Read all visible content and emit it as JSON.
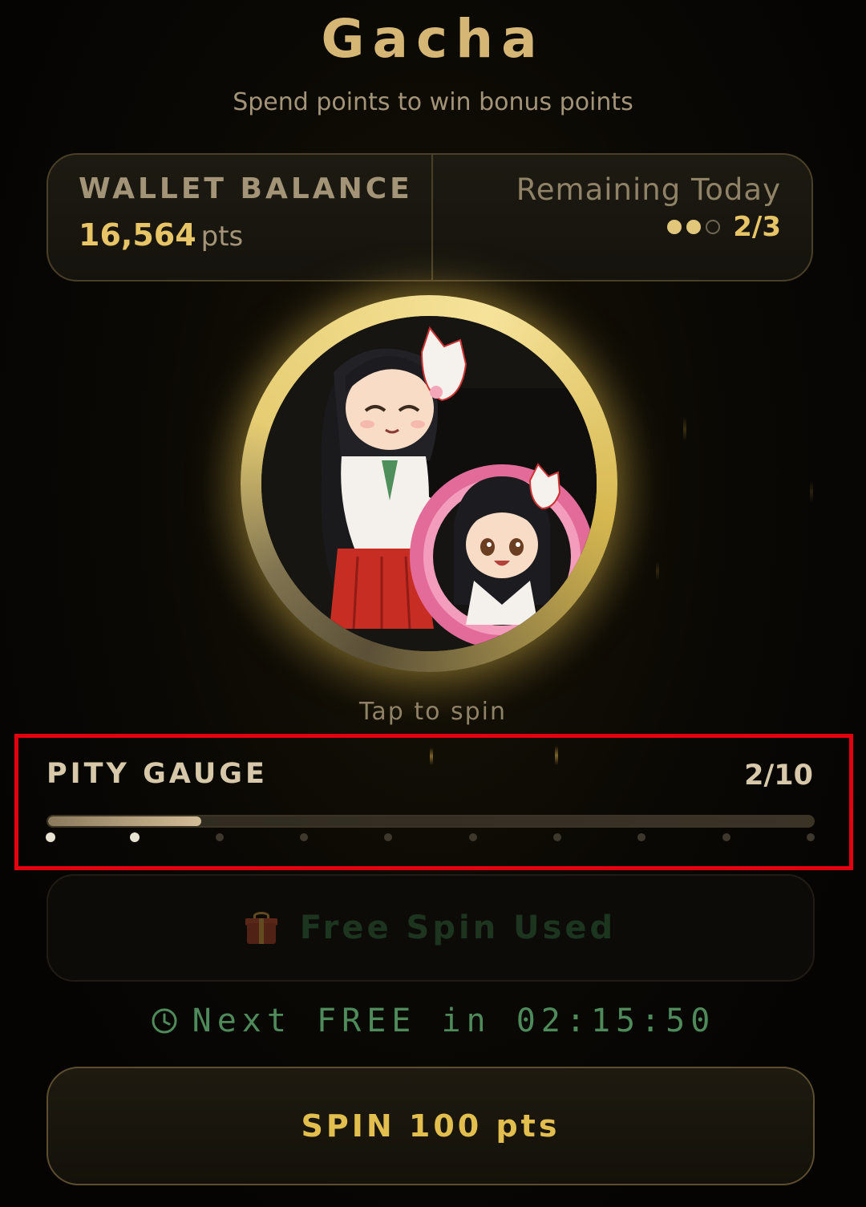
{
  "header": {
    "title": "Gacha",
    "subtitle": "Spend points to win bonus points"
  },
  "wallet": {
    "label": "WALLET BALANCE",
    "value": "16,564",
    "unit": "pts"
  },
  "remaining": {
    "label": "Remaining Today",
    "count": "2/3",
    "used": 2,
    "total": 3
  },
  "spinner": {
    "hint": "Tap to spin",
    "image": "shrine-maiden-coin-icon"
  },
  "pity": {
    "label": "PITY GAUGE",
    "count": "2/10",
    "current": 2,
    "max": 10
  },
  "free_spin": {
    "label": "Free Spin Used",
    "icon": "gift-icon"
  },
  "timer": {
    "text": "Next FREE in 02:15:50",
    "icon": "clock-icon"
  },
  "spin_button": {
    "label": "SPIN 100 pts"
  },
  "colors": {
    "accent_gold": "#e2be4e",
    "title_gold": "#d6b674",
    "timer_green": "#4e8a5a",
    "highlight_red": "#e4000f"
  }
}
